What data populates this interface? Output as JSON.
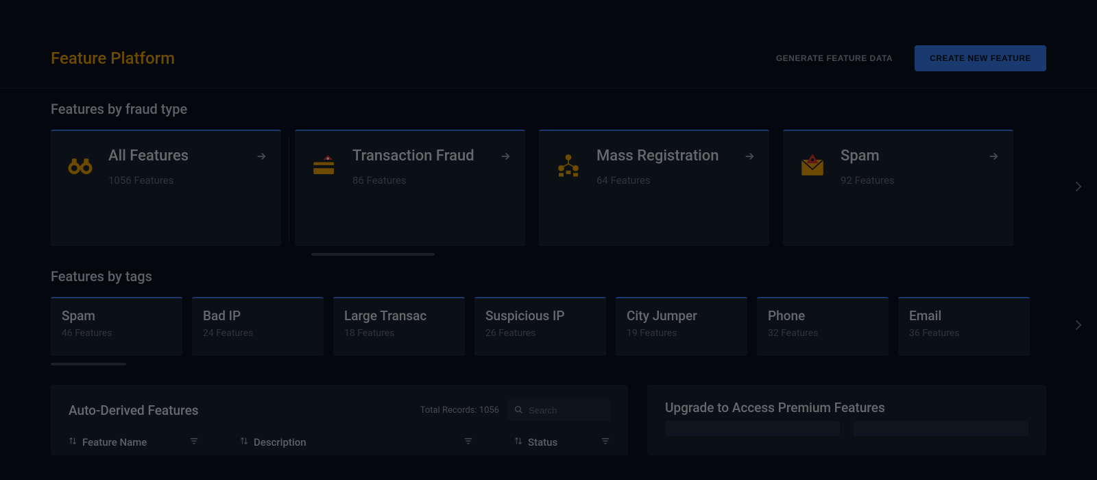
{
  "header": {
    "title": "Feature Platform",
    "generate_label": "GENERATE FEATURE DATA",
    "create_label": "CREATE NEW FEATURE"
  },
  "sections": {
    "fraud_title": "Features by fraud type",
    "tags_title": "Features by tags",
    "auto_derived_title": "Auto-Derived Features",
    "premium_title": "Upgrade to Access Premium Features"
  },
  "fraud_cards": [
    {
      "title": "All Features",
      "count": "1056 Features",
      "icon": "binoculars"
    },
    {
      "title": "Transaction Fraud",
      "count": "86 Features",
      "icon": "card"
    },
    {
      "title": "Mass Registration",
      "count": "64 Features",
      "icon": "group"
    },
    {
      "title": "Spam",
      "count": "92 Features",
      "icon": "spam-mail"
    }
  ],
  "tag_cards": [
    {
      "title": "Spam",
      "count": "46 Features"
    },
    {
      "title": "Bad IP",
      "count": "24 Features"
    },
    {
      "title": "Large Transac",
      "count": "18 Features"
    },
    {
      "title": "Suspicious IP",
      "count": "26 Features"
    },
    {
      "title": "City Jumper",
      "count": "19 Features"
    },
    {
      "title": "Phone",
      "count": "32 Features"
    },
    {
      "title": "Email",
      "count": "36 Features"
    }
  ],
  "table": {
    "total_records_label": "Total Records: 1056",
    "search_placeholder": "Search",
    "columns": {
      "name": "Feature Name",
      "description": "Description",
      "status": "Status"
    }
  }
}
